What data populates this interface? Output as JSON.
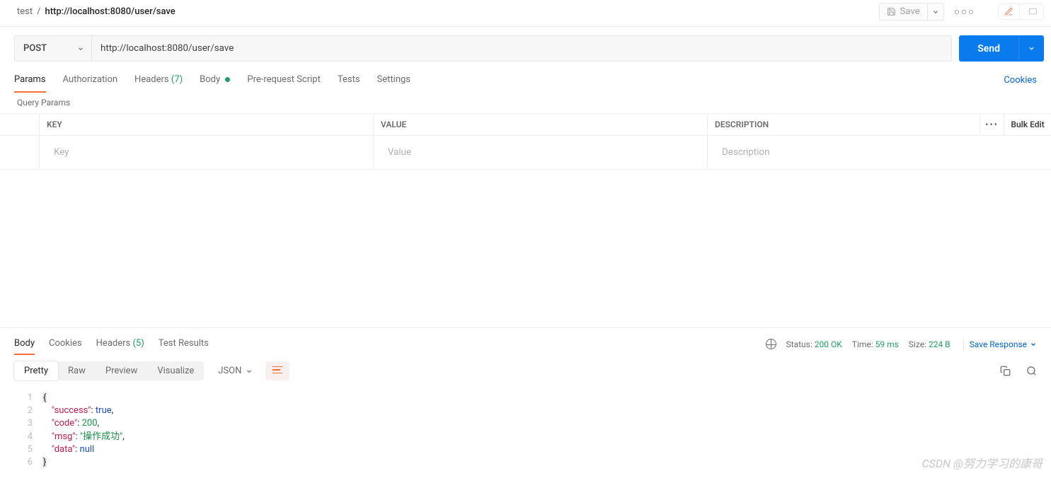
{
  "breadcrumb": {
    "collection": "test",
    "separator": "/",
    "request_name": "http://localhost:8080/user/save"
  },
  "header_actions": {
    "save_label": "Save"
  },
  "request": {
    "method": "POST",
    "url": "http://localhost:8080/user/save",
    "send_label": "Send"
  },
  "req_tabs": {
    "params": "Params",
    "authorization": "Authorization",
    "headers": "Headers",
    "headers_count": "(7)",
    "body": "Body",
    "prerequest": "Pre-request Script",
    "tests": "Tests",
    "settings": "Settings",
    "cookies": "Cookies"
  },
  "query": {
    "section_label": "Query Params",
    "head_key": "KEY",
    "head_value": "VALUE",
    "head_desc": "DESCRIPTION",
    "bulk_label": "Bulk Edit",
    "placeholder_key": "Key",
    "placeholder_value": "Value",
    "placeholder_desc": "Description"
  },
  "resp_tabs": {
    "body": "Body",
    "cookies": "Cookies",
    "headers": "Headers",
    "headers_count": "(5)",
    "test_results": "Test Results"
  },
  "resp_status": {
    "status_label": "Status:",
    "status_value": "200 OK",
    "time_label": "Time:",
    "time_value": "59 ms",
    "size_label": "Size:",
    "size_value": "224 B",
    "save_resp": "Save Response"
  },
  "view_tabs": {
    "pretty": "Pretty",
    "raw": "Raw",
    "preview": "Preview",
    "visualize": "Visualize",
    "format": "JSON"
  },
  "response_body": {
    "success_key": "\"success\"",
    "success_val": "true",
    "code_key": "\"code\"",
    "code_val": "200",
    "msg_key": "\"msg\"",
    "msg_val": "\"操作成功\"",
    "data_key": "\"data\"",
    "data_val": "null"
  },
  "line_numbers": {
    "l1": "1",
    "l2": "2",
    "l3": "3",
    "l4": "4",
    "l5": "5",
    "l6": "6"
  },
  "watermark": "CSDN @努力学习的康哥"
}
